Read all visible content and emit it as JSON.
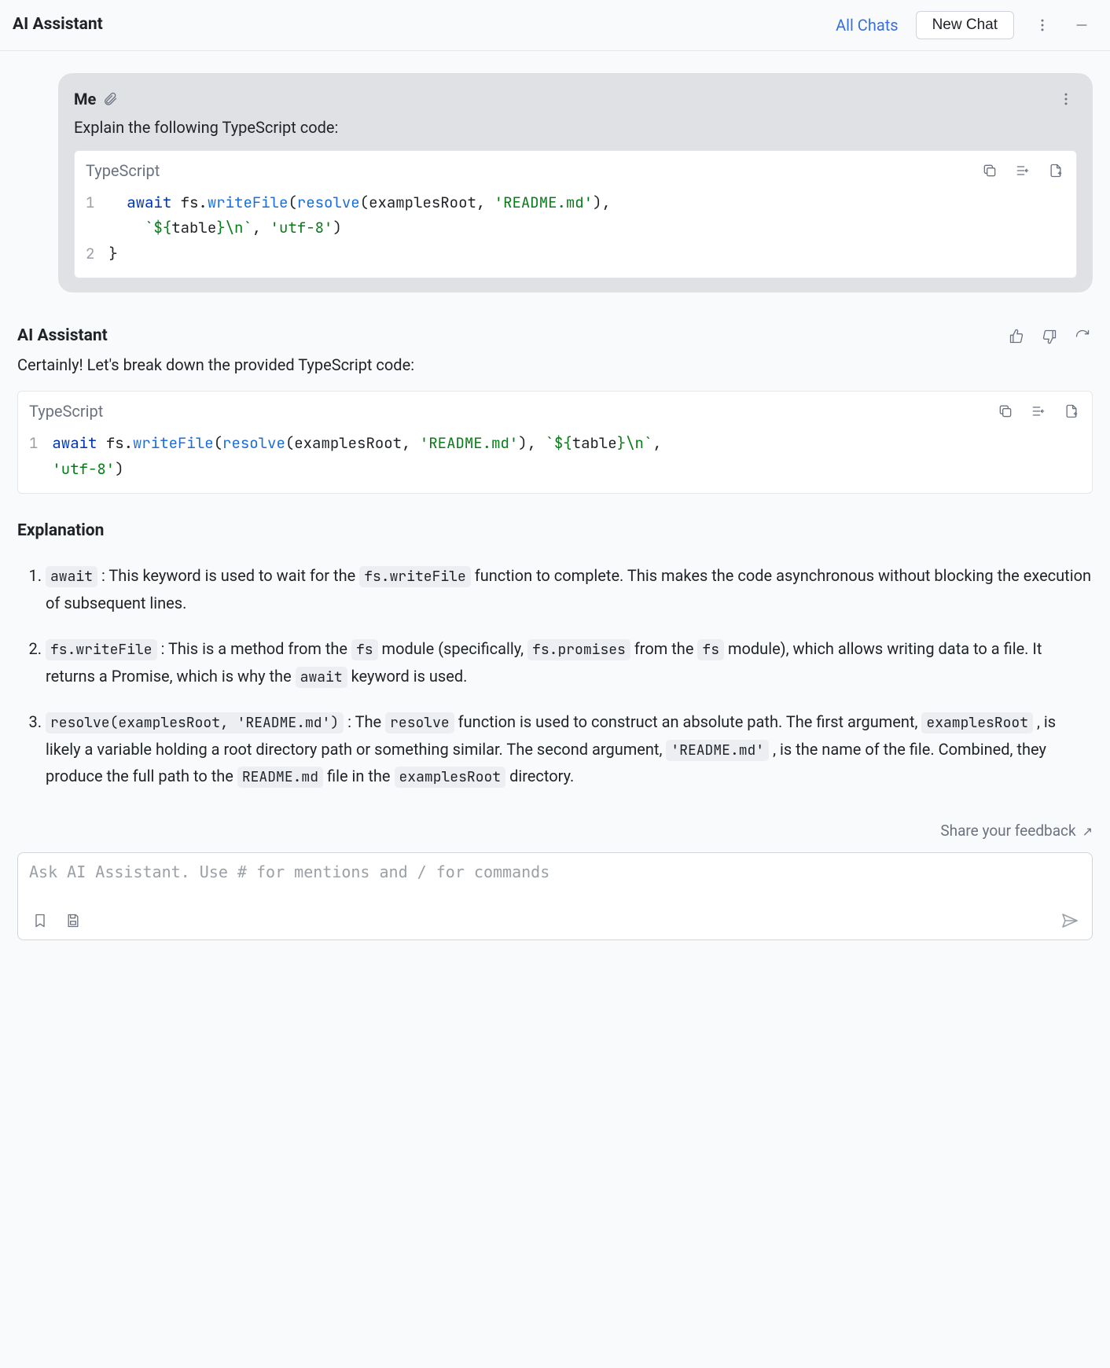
{
  "header": {
    "title": "AI Assistant",
    "all_chats": "All Chats",
    "new_chat": "New Chat"
  },
  "user_msg": {
    "who": "Me",
    "text": "Explain the following TypeScript code:",
    "code_lang": "TypeScript",
    "code_line1_a": "  await",
    "code_line1_b": " fs.",
    "code_line1_c": "writeFile",
    "code_line1_d": "(",
    "code_line1_e": "resolve",
    "code_line1_f": "(examplesRoot, ",
    "code_line1_g": "'README.md'",
    "code_line1_h": "),",
    "code_line1_cont_a": "    `${",
    "code_line1_cont_b": "table",
    "code_line1_cont_c": "}\\n`",
    "code_line1_cont_d": ", ",
    "code_line1_cont_e": "'utf-8'",
    "code_line1_cont_f": ")",
    "code_line2": "}",
    "ln1": "1",
    "ln2": "2"
  },
  "assistant_msg": {
    "who": "AI Assistant",
    "intro": "Certainly! Let's break down the provided TypeScript code:",
    "code_lang": "TypeScript",
    "ln1": "1",
    "code_a": "await",
    "code_b": " fs.",
    "code_c": "writeFile",
    "code_d": "(",
    "code_e": "resolve",
    "code_f": "(examplesRoot, ",
    "code_g": "'README.md'",
    "code_h": "), ",
    "code_i": "`${",
    "code_j": "table",
    "code_k": "}\\n`",
    "code_l": ", ",
    "code_cont_a": "'utf-8'",
    "code_cont_b": ")",
    "explanation_title": "Explanation",
    "item1_code1": "await",
    "item1_text1": " : This keyword is used to wait for the ",
    "item1_code2": "fs.writeFile",
    "item1_text2": " function to complete. This makes the code asynchronous without blocking the execution of subsequent lines.",
    "item2_code1": "fs.writeFile",
    "item2_text1": " : This is a method from the ",
    "item2_code2": "fs",
    "item2_text2": " module (specifically, ",
    "item2_code3": "fs.promises",
    "item2_text3": " from the ",
    "item2_code4": "fs",
    "item2_text4": " module), which allows writing data to a file. It returns a Promise, which is why the ",
    "item2_code5": "await",
    "item2_text5": " keyword is used.",
    "item3_code1": "resolve(examplesRoot, 'README.md')",
    "item3_text1": " : The ",
    "item3_code2": "resolve",
    "item3_text2": " function is used to construct an absolute path. The first argument, ",
    "item3_code3": "examplesRoot",
    "item3_text3": " , is likely a variable holding a root directory path or something similar. The second argument, ",
    "item3_code4": "'README.md'",
    "item3_text4": " , is the name of the file. Combined, they produce the full path to the ",
    "item3_code5": "README.md",
    "item3_text5": " file in the ",
    "item3_code6": "examplesRoot",
    "item3_text6": " directory."
  },
  "footer": {
    "feedback": "Share your feedback",
    "placeholder": "Ask AI Assistant. Use # for mentions and / for commands"
  }
}
